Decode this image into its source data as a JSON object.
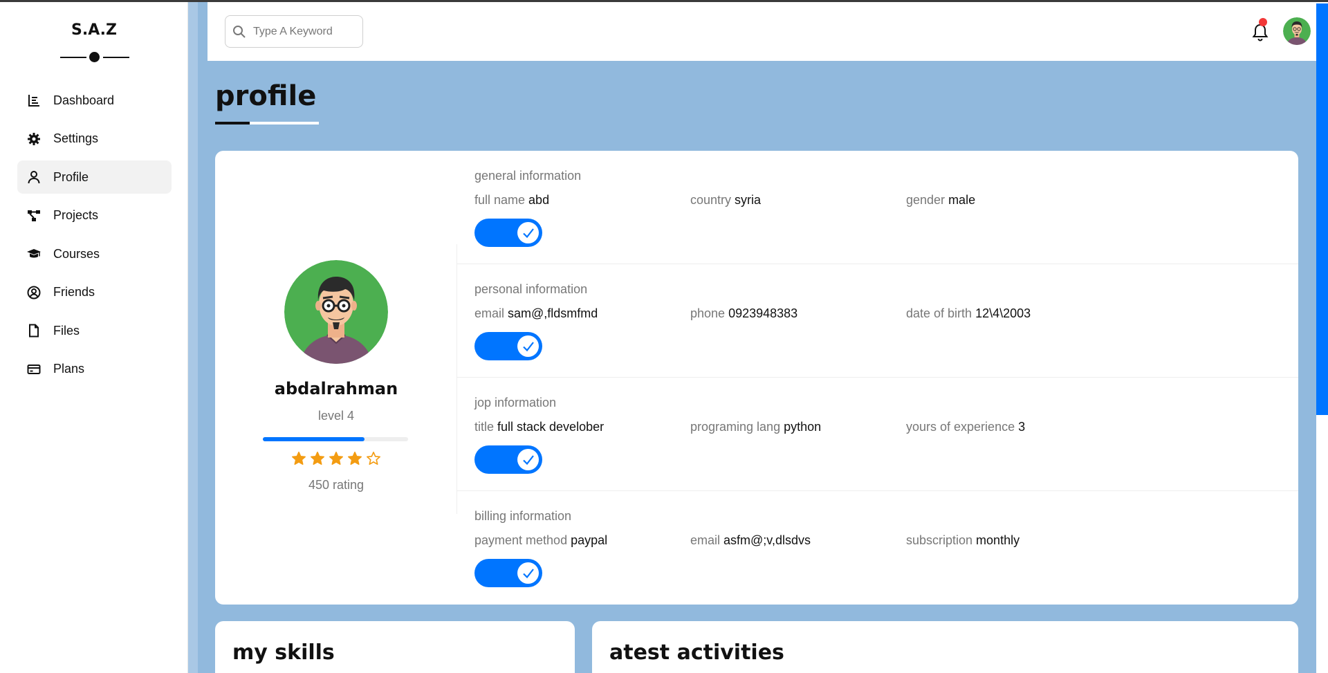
{
  "brand": {
    "logo": "S.A.Z"
  },
  "sidebar": {
    "items": [
      {
        "label": "Dashboard",
        "icon": "chart-icon"
      },
      {
        "label": "Settings",
        "icon": "gear-icon"
      },
      {
        "label": "Profile",
        "icon": "user-icon",
        "active": true
      },
      {
        "label": "Projects",
        "icon": "diagram-icon"
      },
      {
        "label": "Courses",
        "icon": "graduation-cap-icon"
      },
      {
        "label": "Friends",
        "icon": "user-circle-icon"
      },
      {
        "label": "Files",
        "icon": "file-icon"
      },
      {
        "label": "Plans",
        "icon": "credit-card-icon"
      }
    ]
  },
  "header": {
    "search_placeholder": "Type A Keyword",
    "notification_badge_color": "#f23838"
  },
  "page": {
    "title": "profile"
  },
  "profile": {
    "name": "abdalrahman",
    "level": "level 4",
    "progress": 0.7,
    "stars": {
      "filled": 4,
      "total": 5
    },
    "rating": "450 rating",
    "sections": [
      {
        "title": "general information",
        "fields": [
          {
            "label": "full name",
            "value": "abd"
          },
          {
            "label": "country",
            "value": "syria"
          },
          {
            "label": "gender",
            "value": "male"
          }
        ],
        "toggle": true
      },
      {
        "title": "personal information",
        "fields": [
          {
            "label": "email",
            "value": "sam@,fldsmfmd"
          },
          {
            "label": "phone",
            "value": "0923948383"
          },
          {
            "label": "date of birth",
            "value": "12\\4\\2003"
          }
        ],
        "toggle": true
      },
      {
        "title": "jop information",
        "fields": [
          {
            "label": "title",
            "value": "full stack develober"
          },
          {
            "label": "programing lang",
            "value": "python"
          },
          {
            "label": "yours of experience",
            "value": "3"
          }
        ],
        "toggle": true
      },
      {
        "title": "billing information",
        "fields": [
          {
            "label": "payment method",
            "value": "paypal"
          },
          {
            "label": "email",
            "value": "asfm@;v,dlsdvs"
          },
          {
            "label": "subscription",
            "value": "monthly"
          }
        ],
        "toggle": true
      }
    ]
  },
  "bottom_cards": {
    "skills_title": "my skills",
    "activities_title": "atest activities"
  },
  "colors": {
    "accent": "#0075ff",
    "main_bg": "#91b9dd",
    "star": "#f39c12"
  }
}
